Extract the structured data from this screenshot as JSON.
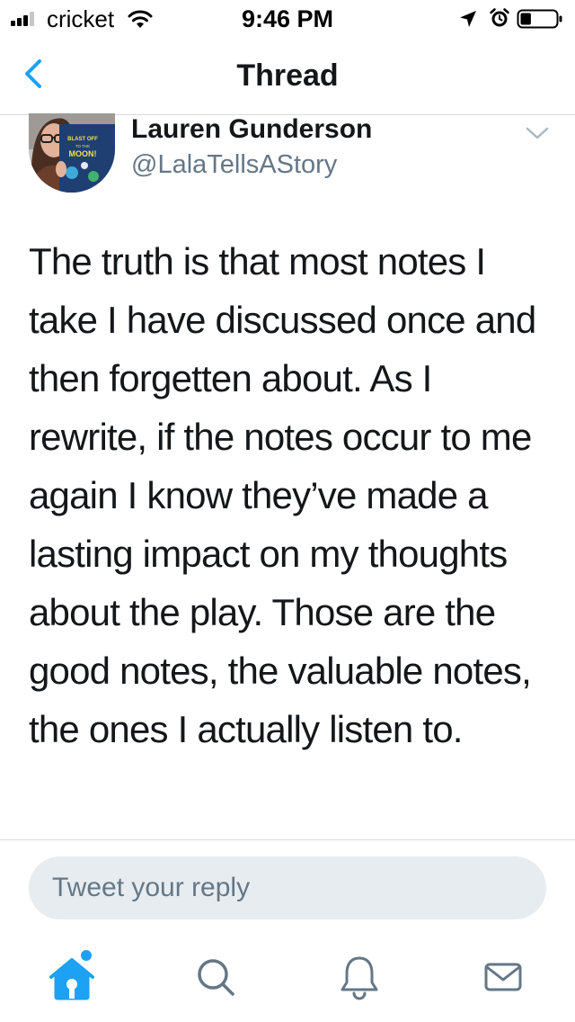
{
  "status_bar": {
    "carrier": "cricket",
    "time": "9:46 PM",
    "signal_bars_filled": 3,
    "signal_bars_total": 4,
    "battery_level": 0.3
  },
  "nav": {
    "title": "Thread",
    "back_icon": "chevron-left-icon"
  },
  "tweet": {
    "author_name": "Lauren Gunderson",
    "author_handle": "@LalaTellsAStory",
    "avatar_book_text": [
      "BLAST OFF",
      "TO THE",
      "MOON!"
    ],
    "text": "The truth is that most notes I take I have discussed once and then forgetten about. As I rewrite, if the notes occur to me again I know they’ve made a lasting impact on my thoughts about the play. Those are the good notes, the valuable notes, the ones I actually listen to.",
    "menu_icon": "chevron-down-icon"
  },
  "reply": {
    "placeholder": "Tweet your reply"
  },
  "tabs": [
    {
      "name": "home",
      "icon": "home-icon",
      "active": true,
      "has_notification_dot": true
    },
    {
      "name": "search",
      "icon": "search-icon",
      "active": false
    },
    {
      "name": "notifications",
      "icon": "bell-icon",
      "active": false
    },
    {
      "name": "messages",
      "icon": "mail-icon",
      "active": false
    }
  ],
  "colors": {
    "accent": "#1da1f2",
    "text_primary": "#14171a",
    "text_secondary": "#657786",
    "divider": "#d6d9db",
    "input_background": "#e6ecf0"
  }
}
